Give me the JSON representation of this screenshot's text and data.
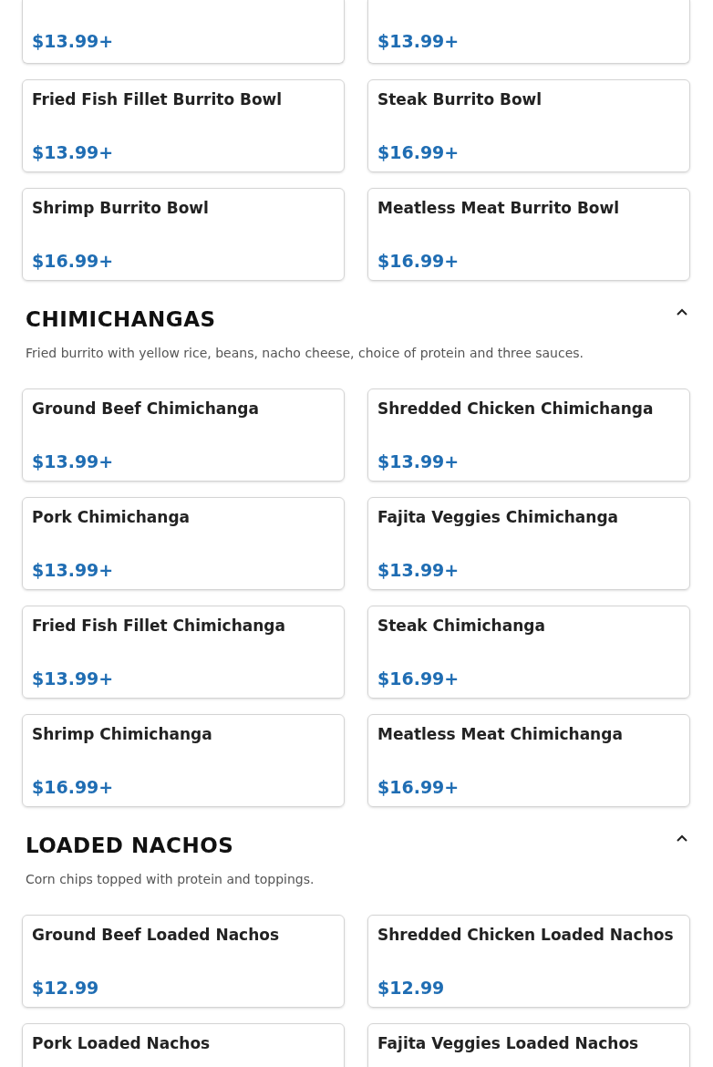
{
  "top_items": [
    {
      "price": "$13.99+"
    },
    {
      "price": "$13.99+"
    }
  ],
  "items": [
    {
      "name": "Fried Fish Fillet Burrito Bowl",
      "price": "$13.99+"
    },
    {
      "name": "Steak Burrito Bowl",
      "price": "$16.99+"
    },
    {
      "name": "Shrimp Burrito Bowl",
      "price": "$16.99+"
    },
    {
      "name": "Meatless Meat Burrito Bowl",
      "price": "$16.99+"
    }
  ],
  "sections": [
    {
      "title": "CHIMICHANGAS",
      "expanded": true,
      "description": "Fried burrito with yellow rice, beans, nacho cheese, choice of protein and three sauces.",
      "items": [
        {
          "name": "Ground Beef Chimichanga",
          "price": "$13.99+"
        },
        {
          "name": "Shredded Chicken Chimichanga",
          "price": "$13.99+"
        },
        {
          "name": "Pork Chimichanga",
          "price": "$13.99+"
        },
        {
          "name": "Fajita Veggies Chimichanga",
          "price": "$13.99+"
        },
        {
          "name": "Fried Fish Fillet Chimichanga",
          "price": "$13.99+"
        },
        {
          "name": "Steak Chimichanga",
          "price": "$16.99+"
        },
        {
          "name": "Shrimp Chimichanga",
          "price": "$16.99+"
        },
        {
          "name": "Meatless Meat Chimichanga",
          "price": "$16.99+"
        }
      ]
    },
    {
      "title": "LOADED NACHOS",
      "expanded": true,
      "description": "Corn chips topped with protein and toppings.",
      "items": [
        {
          "name": "Ground Beef Loaded Nachos",
          "price": "$12.99"
        },
        {
          "name": "Shredded Chicken Loaded Nachos",
          "price": "$12.99"
        },
        {
          "name": "Pork Loaded Nachos"
        },
        {
          "name": "Fajita Veggies Loaded Nachos"
        }
      ]
    }
  ]
}
